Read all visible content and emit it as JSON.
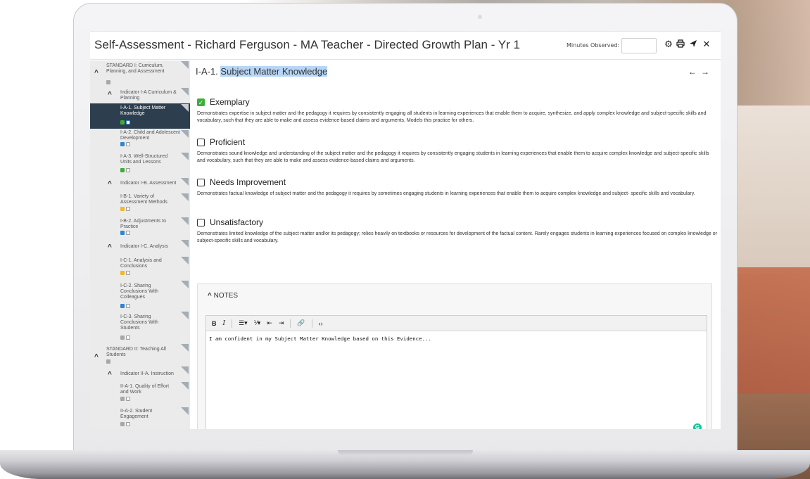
{
  "window": {
    "title": "Self-Assessment - Richard Ferguson - MA Teacher - Directed Growth Plan - Yr 1",
    "minutes_label": "Minutes Observed:",
    "minutes_value": "",
    "icons": [
      "gear-icon",
      "print-icon",
      "send-icon",
      "close-icon"
    ]
  },
  "sidebar": {
    "items": [
      {
        "label": "STANDARD I: Curriculum, Planning, and Assessment",
        "level": "standard",
        "badges": [
          "check"
        ]
      },
      {
        "label": "Indicator I-A Curriculum & Planning",
        "level": "indicator"
      },
      {
        "label": "I-A-1. Subject Matter Knowledge",
        "level": "element",
        "active": true,
        "badges": [
          "green",
          "note-blue"
        ]
      },
      {
        "label": "I-A-2. Child and Adolescent Development",
        "level": "element",
        "badges": [
          "blue",
          "note"
        ]
      },
      {
        "label": "I-A-3. Well-Structured Units and Lessons",
        "level": "element",
        "badges": [
          "green",
          "note"
        ]
      },
      {
        "label": "Indicator I-B. Assessment",
        "level": "indicator"
      },
      {
        "label": "I-B-1. Variety of Assessment Methods",
        "level": "element",
        "badges": [
          "yellow",
          "note"
        ]
      },
      {
        "label": "I-B-2. Adjustments to Practice",
        "level": "element",
        "badges": [
          "blue",
          "note"
        ]
      },
      {
        "label": "Indicator I-C. Analysis",
        "level": "indicator"
      },
      {
        "label": "I-C-1. Analysis and Conclusions",
        "level": "element",
        "badges": [
          "yellow",
          "note"
        ]
      },
      {
        "label": "I-C-2. Sharing Conclusions With Colleagues",
        "level": "element",
        "badges": [
          "blue",
          "note"
        ]
      },
      {
        "label": "I-C-3. Sharing Conclusions With Students",
        "level": "element",
        "badges": [
          "check",
          "note"
        ]
      },
      {
        "label": "STANDARD II: Teaching All Students",
        "level": "standard",
        "badges": [
          "check"
        ]
      },
      {
        "label": "Indicator II-A. Instruction",
        "level": "indicator"
      },
      {
        "label": "II-A-1. Quality of Effort and Work",
        "level": "element",
        "badges": [
          "check",
          "note"
        ]
      },
      {
        "label": "II-A-2. Student Engagement",
        "level": "element",
        "badges": [
          "check",
          "note"
        ]
      }
    ]
  },
  "main": {
    "heading_prefix": "I-A-1.",
    "heading_title": "Subject Matter Knowledge",
    "ratings": [
      {
        "label": "Exemplary",
        "checked": true,
        "description": "Demonstrates expertise in subject matter and the pedagogy it requires by consistently engaging all students in learning experiences that enable them to acquire, synthesize, and apply complex knowledge and subject-specific skills and vocabulary, such that they are able to make and assess evidence-based claims and arguments. Models this practice for others."
      },
      {
        "label": "Proficient",
        "checked": false,
        "description": "Demonstrates sound knowledge and understanding of the subject matter and the pedagogy it requires by consistently engaging students in learning experiences that enable them to acquire complex knowledge and subject-specific skills and vocabulary, such that they are able to make and assess evidence-based claims and arguments."
      },
      {
        "label": "Needs Improvement",
        "checked": false,
        "description": "Demonstrates factual knowledge of subject matter and the pedagogy it requires by sometimes engaging students in learning experiences that enable them to acquire complex knowledge and subject- specific skills and vocabulary."
      },
      {
        "label": "Unsatisfactory",
        "checked": false,
        "description": "Demonstrates limited knowledge of the subject matter and/or its pedagogy; relies heavily on textbooks or resources for development of the factual content. Rarely engages students in learning experiences focused on complex knowledge or subject-specific skills and vocabulary."
      }
    ],
    "notes": {
      "header": "NOTES",
      "text": "I am confident in my Subject Matter Knowledge based on this Evidence...",
      "toolbar": [
        "B",
        "I",
        "bulleted-list",
        "numbered-list",
        "outdent",
        "indent",
        "link",
        "code"
      ]
    }
  }
}
